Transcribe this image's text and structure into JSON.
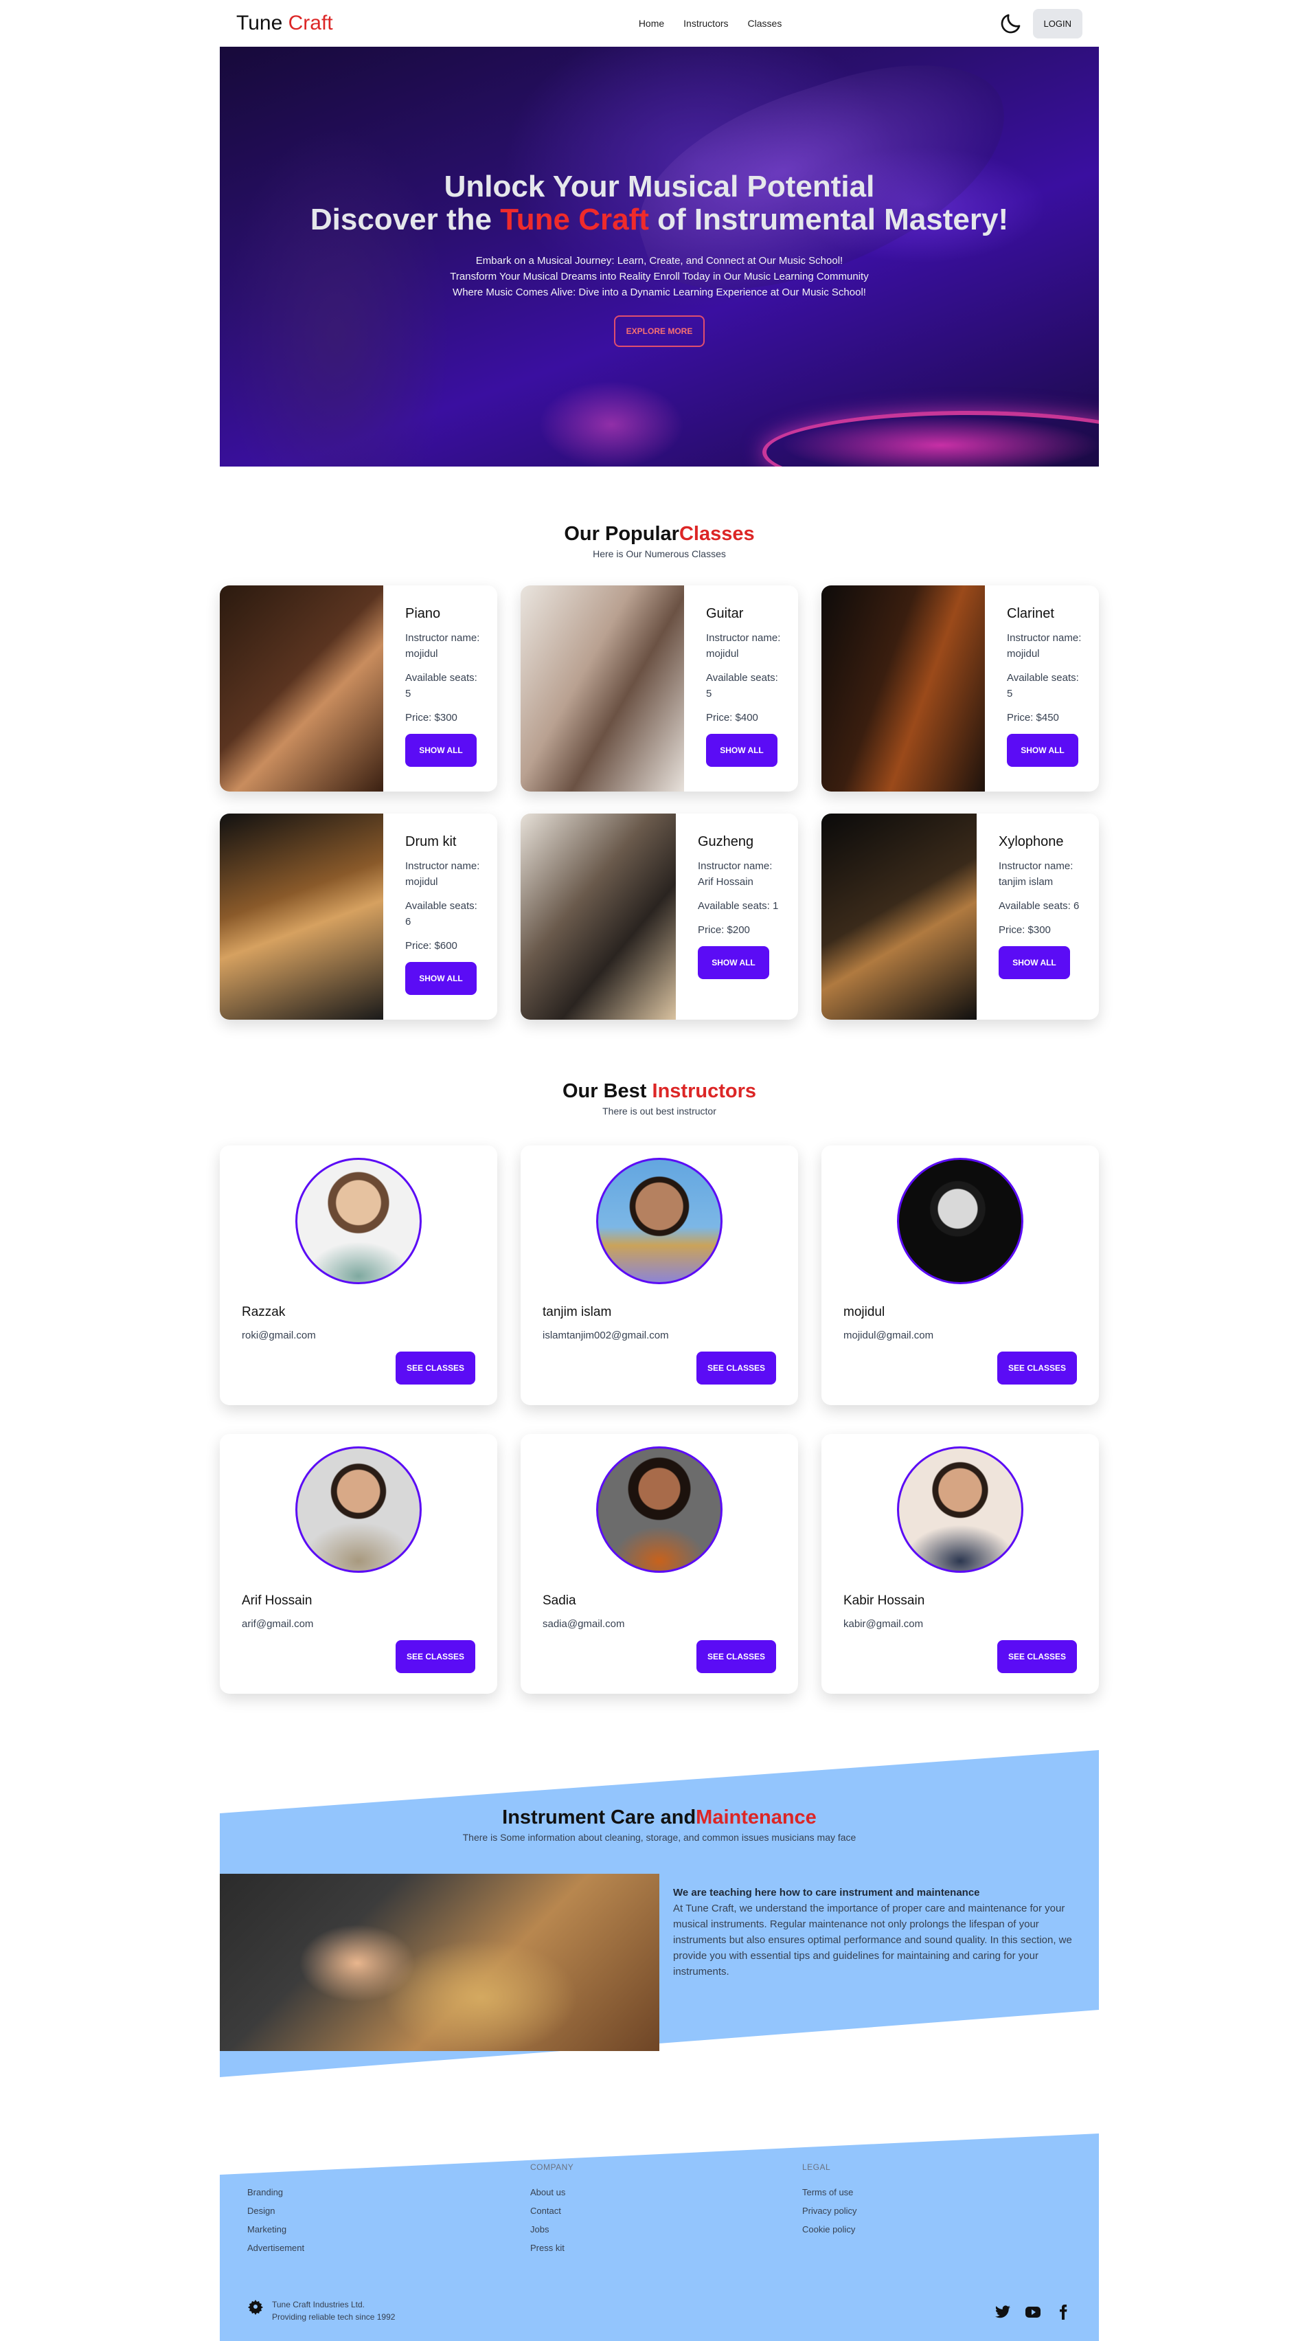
{
  "nav": {
    "logo_main": "Tune ",
    "logo_accent": "Craft",
    "links": [
      "Home",
      "Instructors",
      "Classes"
    ],
    "login": "LOGIN"
  },
  "hero": {
    "title_line1": "Unlock Your Musical Potential",
    "title_line2_pre": "Discover the ",
    "title_line2_accent": "Tune Craft",
    "title_line2_post": " of Instrumental Mastery!",
    "sub1": "Embark on a Musical Journey: Learn, Create, and Connect at Our Music School!",
    "sub2": "Transform Your Musical Dreams into Reality Enroll Today in Our Music Learning Community",
    "sub3": "Where Music Comes Alive: Dive into a Dynamic Learning Experience at Our Music School!",
    "button": "EXPLORE MORE"
  },
  "classes": {
    "title_pre": "Our Popular",
    "title_accent": "Classes",
    "subtitle": "Here is Our Numerous Classes",
    "items": [
      {
        "name": "Piano",
        "instructor": "Instructor name: mojidul",
        "seats": "Available seats: 5",
        "price": "Price: $300",
        "button": "SHOW ALL"
      },
      {
        "name": "Guitar",
        "instructor": "Instructor name: mojidul",
        "seats": "Available seats: 5",
        "price": "Price: $400",
        "button": "SHOW ALL"
      },
      {
        "name": "Clarinet",
        "instructor": "Instructor name: mojidul",
        "seats": "Available seats: 5",
        "price": "Price: $450",
        "button": "SHOW ALL"
      },
      {
        "name": "Drum kit",
        "instructor": "Instructor name: mojidul",
        "seats": "Available seats: 6",
        "price": "Price: $600",
        "button": "SHOW ALL"
      },
      {
        "name": "Guzheng",
        "instructor": "Instructor name: Arif Hossain",
        "seats": "Available seats: 1",
        "price": "Price: $200",
        "button": "SHOW ALL"
      },
      {
        "name": "Xylophone",
        "instructor": "Instructor name: tanjim islam",
        "seats": "Available seats: 6",
        "price": "Price: $300",
        "button": "SHOW ALL"
      }
    ]
  },
  "instructors": {
    "title_pre": "Our Best ",
    "title_accent": "Instructors",
    "subtitle": "There is out best instructor",
    "items": [
      {
        "name": "Razzak",
        "email": "roki@gmail.com",
        "button": "SEE CLASSES"
      },
      {
        "name": "tanjim islam",
        "email": "islamtanjim002@gmail.com",
        "button": "SEE CLASSES"
      },
      {
        "name": "mojidul",
        "email": "mojidul@gmail.com",
        "button": "SEE CLASSES"
      },
      {
        "name": "Arif Hossain",
        "email": "arif@gmail.com",
        "button": "SEE CLASSES"
      },
      {
        "name": "Sadia",
        "email": "sadia@gmail.com",
        "button": "SEE CLASSES"
      },
      {
        "name": "Kabir Hossain",
        "email": "kabir@gmail.com",
        "button": "SEE CLASSES"
      }
    ]
  },
  "care": {
    "title_pre": "Instrument Care and",
    "title_accent": "Maintenance",
    "subtitle": "There is Some information about cleaning, storage, and common issues musicians may face",
    "lead": "We are teaching here how to care instrument and maintenance",
    "body": "At Tune Craft, we understand the importance of proper care and maintenance for your musical instruments. Regular maintenance not only prolongs the lifespan of your instruments but also ensures optimal performance and sound quality. In this section, we provide you with essential tips and guidelines for maintaining and caring for your instruments."
  },
  "footer": {
    "col1": {
      "links": [
        "Branding",
        "Design",
        "Marketing",
        "Advertisement"
      ]
    },
    "col2": {
      "heading": "COMPANY",
      "links": [
        "About us",
        "Contact",
        "Jobs",
        "Press kit"
      ]
    },
    "col3": {
      "heading": "LEGAL",
      "links": [
        "Terms of use",
        "Privacy policy",
        "Cookie policy"
      ]
    },
    "brand_line1": "Tune Craft Industries Ltd.",
    "brand_line2": "Providing reliable tech since 1992",
    "social_icons": [
      "twitter-icon",
      "youtube-icon",
      "facebook-icon"
    ]
  },
  "colors": {
    "accent_red": "#dc2626",
    "primary_purple": "#5b0cf5",
    "band_blue": "#93c5fd"
  }
}
